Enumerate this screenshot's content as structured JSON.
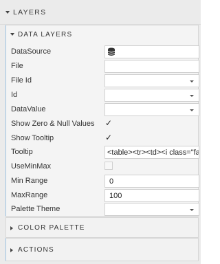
{
  "layers": {
    "title": "LAYERS"
  },
  "data_layers": {
    "title": "DATA LAYERS",
    "fields": {
      "datasource": {
        "label": "DataSource",
        "icon": "database-icon"
      },
      "file": {
        "label": "File",
        "value": ""
      },
      "file_id": {
        "label": "File Id",
        "value": ""
      },
      "id": {
        "label": "Id",
        "value": ""
      },
      "data_value": {
        "label": "DataValue",
        "value": ""
      },
      "show_zero_null": {
        "label": "Show Zero & Null Values",
        "checked": true,
        "mark": "✓"
      },
      "show_tooltip": {
        "label": "Show Tooltip",
        "checked": true,
        "mark": "✓"
      },
      "tooltip": {
        "label": "Tooltip",
        "value": "<table><tr><td><i class=\"fa"
      },
      "use_min_max": {
        "label": "UseMinMax",
        "checked": false
      },
      "min_range": {
        "label": "Min Range",
        "value": "0"
      },
      "max_range": {
        "label": "MaxRange",
        "value": "100"
      },
      "palette_theme": {
        "label": "Palette Theme",
        "value": ""
      }
    }
  },
  "color_palette": {
    "title": "COLOR PALETTE"
  },
  "actions": {
    "title": "ACTIONS"
  },
  "colors": {
    "accent_border": "#9ac0e0",
    "panel_bg": "#ebebeb"
  }
}
